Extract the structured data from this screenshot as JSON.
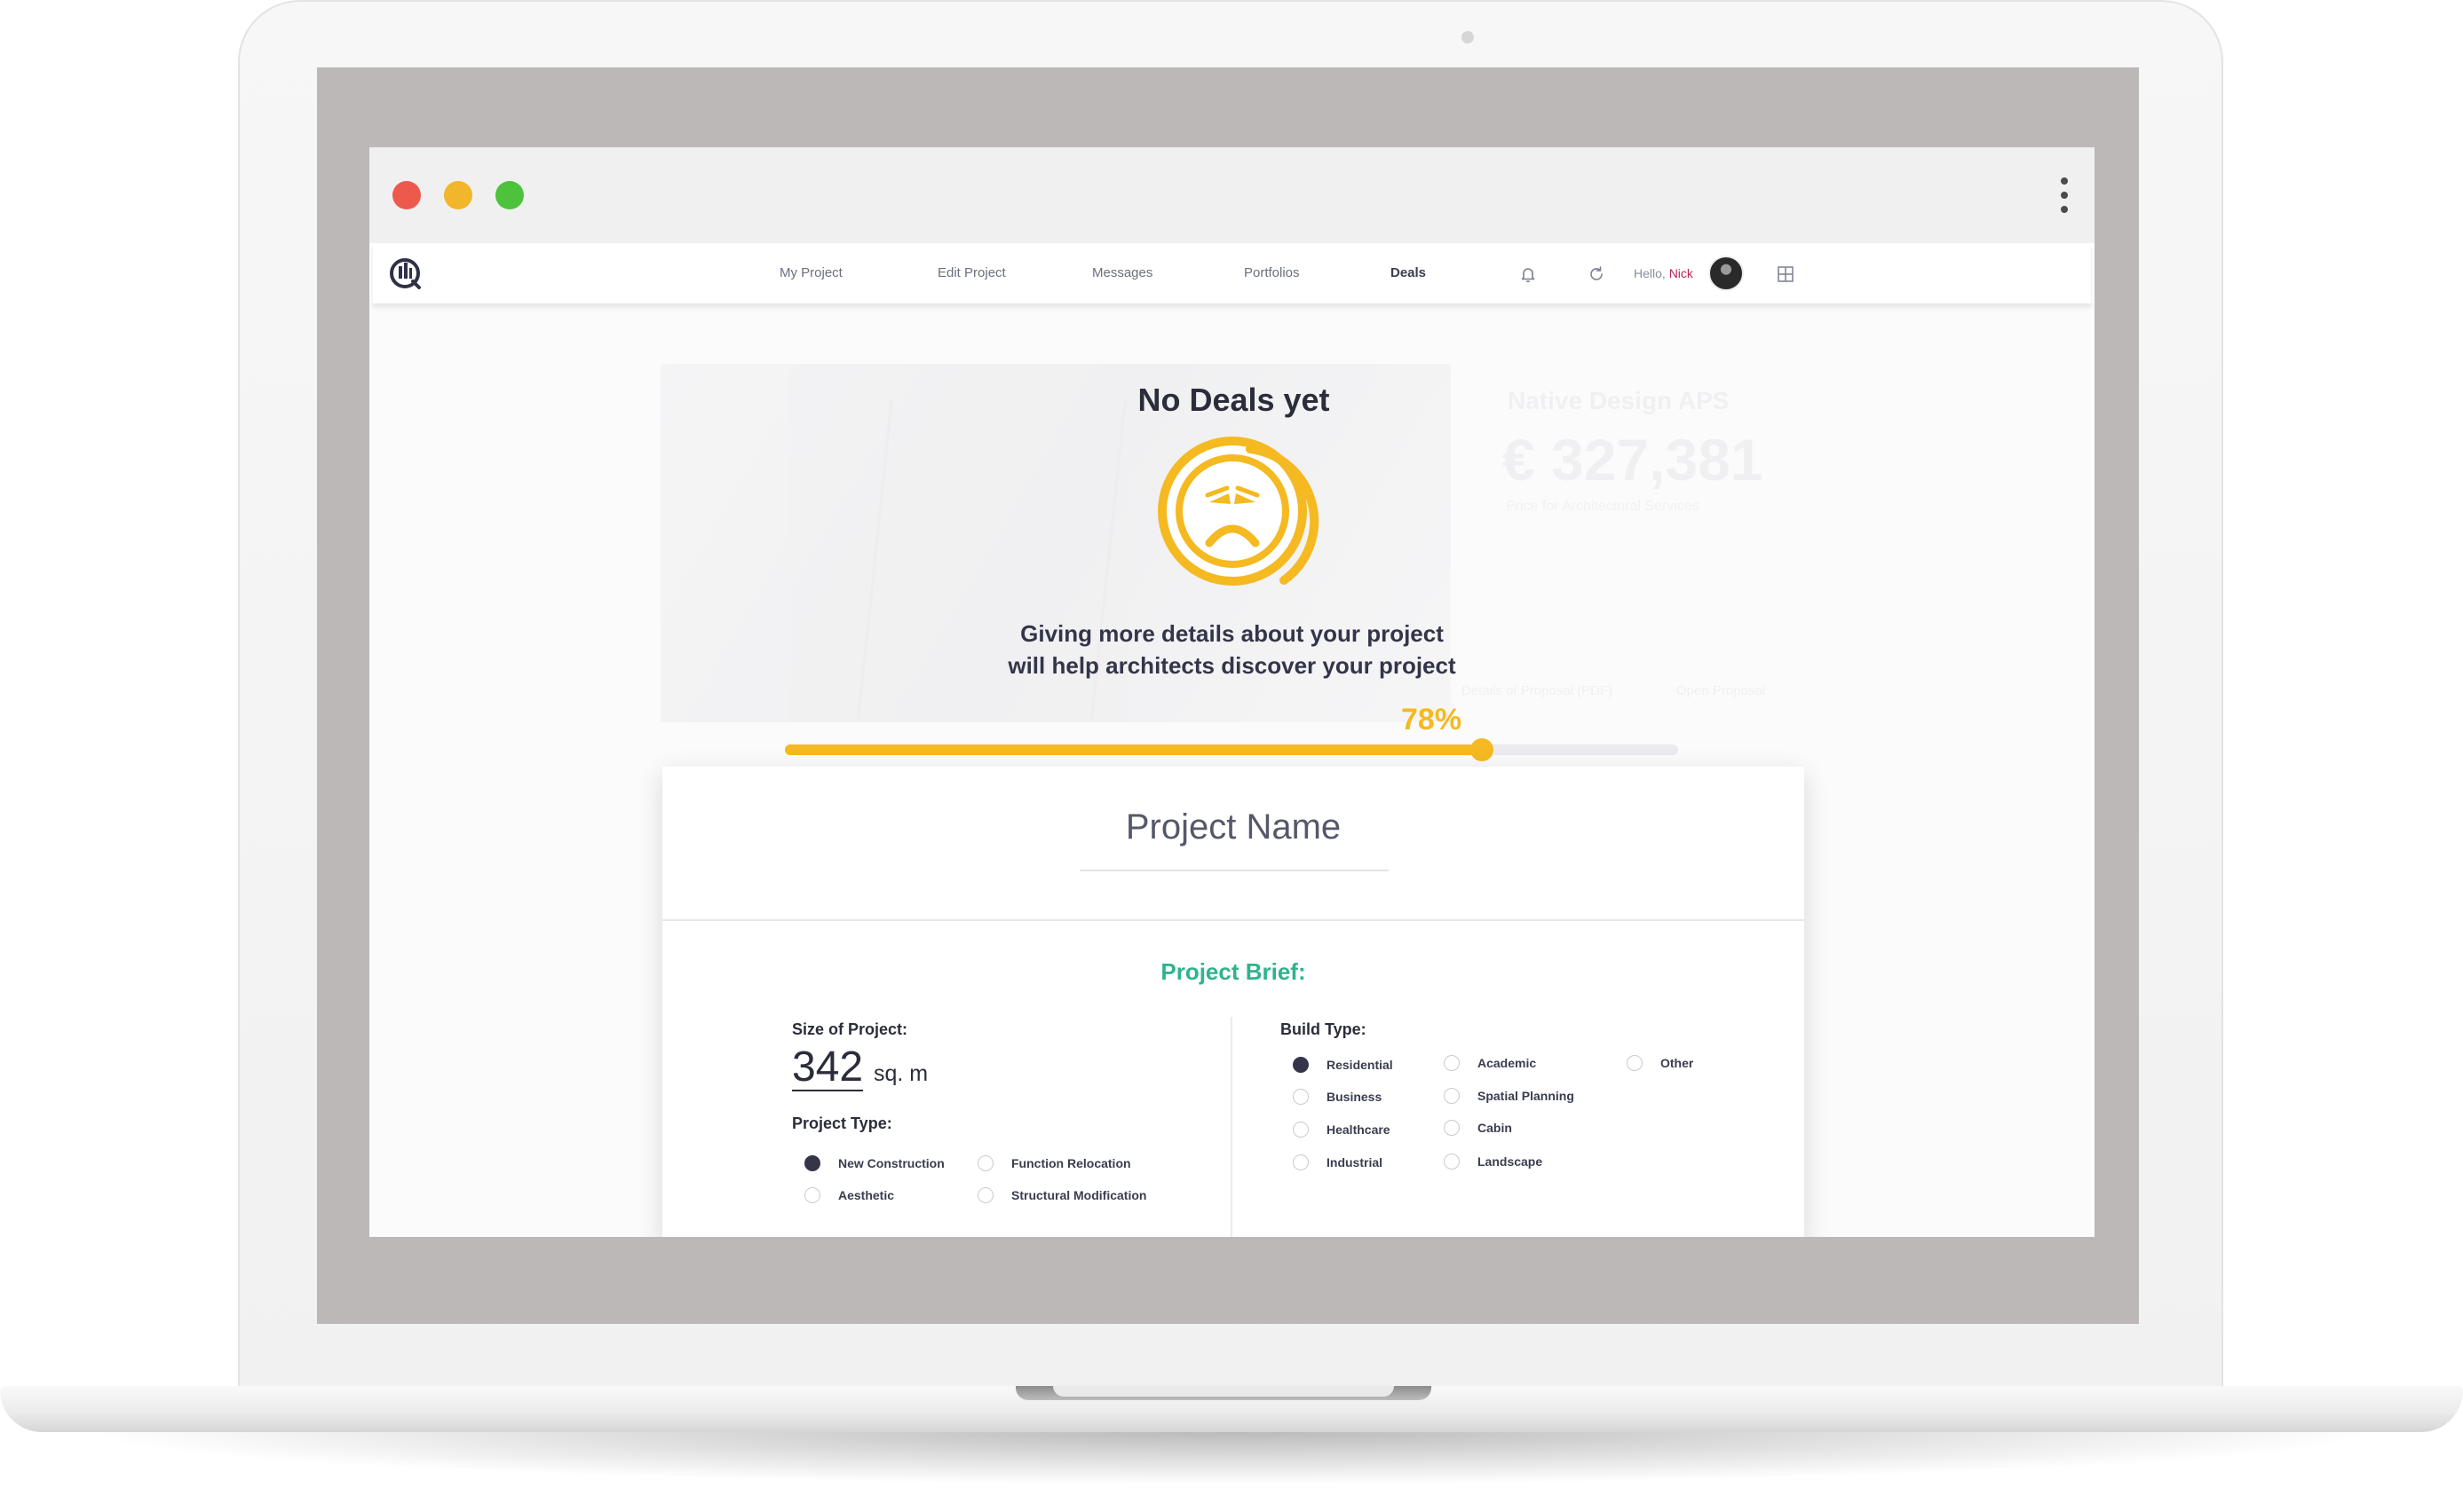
{
  "nav": {
    "items": [
      "My Project",
      "Edit Project",
      "Messages",
      "Portfolios",
      "Deals"
    ],
    "active": "Deals",
    "greeting": "Hello,",
    "user_name": "Nick"
  },
  "background": {
    "firm_name": "Native Design APS",
    "amount": "€ 327,381",
    "subtitle": "Price for Architectural Services",
    "link_details": "Details of Proposal (PDF)",
    "link_open": "Open Proposal"
  },
  "empty_state": {
    "title": "No Deals yet",
    "hint_line1": "Giving more details about your project",
    "hint_line2": "will help architects discover your project",
    "icon": "sad-face-icon"
  },
  "progress": {
    "label": "78%",
    "value": 0.78,
    "color": "#f5b921"
  },
  "card": {
    "project_name": "Project Name",
    "brief_title": "Project Brief:",
    "size_label": "Size of Project:",
    "size_value": "342",
    "size_unit": "sq. m",
    "project_type_label": "Project Type:",
    "project_types": [
      {
        "label": "New Construction",
        "checked": true
      },
      {
        "label": "Function Relocation",
        "checked": false
      },
      {
        "label": "Aesthetic",
        "checked": false
      },
      {
        "label": "Structural Modification",
        "checked": false
      }
    ],
    "build_type_label": "Build Type:",
    "build_types": [
      {
        "label": "Residential",
        "checked": true
      },
      {
        "label": "Business",
        "checked": false
      },
      {
        "label": "Healthcare",
        "checked": false
      },
      {
        "label": "Industrial",
        "checked": false
      },
      {
        "label": "Academic",
        "checked": false
      },
      {
        "label": "Spatial  Planning",
        "checked": false
      },
      {
        "label": "Cabin",
        "checked": false
      },
      {
        "label": "Landscape",
        "checked": false
      },
      {
        "label": "Other",
        "checked": false
      }
    ]
  },
  "colors": {
    "accent_yellow": "#f5b921",
    "brief_green": "#2fb38e",
    "user_name": "#b8245a"
  }
}
